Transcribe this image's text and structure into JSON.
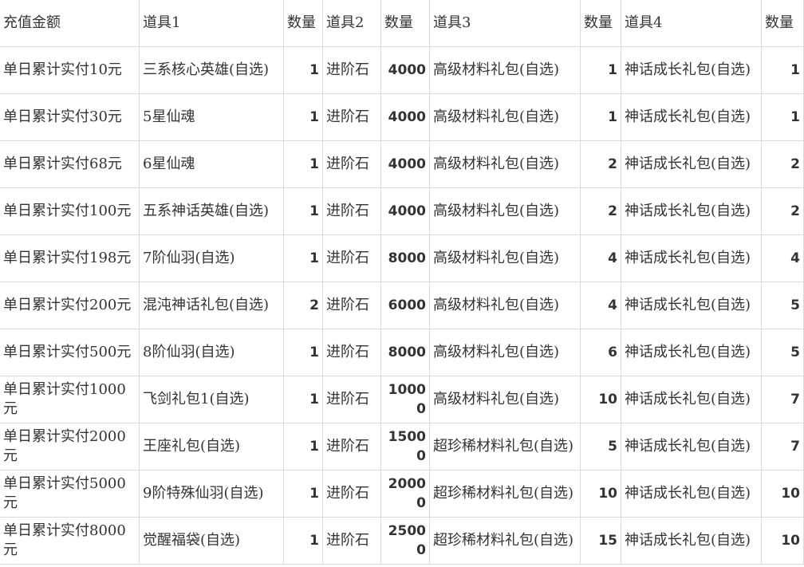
{
  "headers": [
    "充值金额",
    "道具1",
    "数量",
    "道具2",
    "数量",
    "道具3",
    "数量",
    "道具4",
    "数量"
  ],
  "rows": [
    [
      "单日累计实付10元",
      "三系核心英雄(自选)",
      "1",
      "进阶石",
      "4000",
      "高级材料礼包(自选)",
      "1",
      "神话成长礼包(自选)",
      "1"
    ],
    [
      "单日累计实付30元",
      "5星仙魂",
      "1",
      "进阶石",
      "4000",
      "高级材料礼包(自选)",
      "1",
      "神话成长礼包(自选)",
      "1"
    ],
    [
      "单日累计实付68元",
      "6星仙魂",
      "1",
      "进阶石",
      "4000",
      "高级材料礼包(自选)",
      "2",
      "神话成长礼包(自选)",
      "2"
    ],
    [
      "单日累计实付100元",
      "五系神话英雄(自选)",
      "1",
      "进阶石",
      "4000",
      "高级材料礼包(自选)",
      "2",
      "神话成长礼包(自选)",
      "2"
    ],
    [
      "单日累计实付198元",
      "7阶仙羽(自选)",
      "1",
      "进阶石",
      "8000",
      "高级材料礼包(自选)",
      "4",
      "神话成长礼包(自选)",
      "4"
    ],
    [
      "单日累计实付200元",
      "混沌神话礼包(自选)",
      "2",
      "进阶石",
      "6000",
      "高级材料礼包(自选)",
      "4",
      "神话成长礼包(自选)",
      "5"
    ],
    [
      "单日累计实付500元",
      "8阶仙羽(自选)",
      "1",
      "进阶石",
      "8000",
      "高级材料礼包(自选)",
      "6",
      "神话成长礼包(自选)",
      "5"
    ],
    [
      "单日累计实付1000元",
      "飞剑礼包1(自选)",
      "1",
      "进阶石",
      "10000",
      "高级材料礼包(自选)",
      "10",
      "神话成长礼包(自选)",
      "7"
    ],
    [
      "单日累计实付2000元",
      "王座礼包(自选)",
      "1",
      "进阶石",
      "15000",
      "超珍稀材料礼包(自选)",
      "5",
      "神话成长礼包(自选)",
      "7"
    ],
    [
      "单日累计实付5000元",
      "9阶特殊仙羽(自选)",
      "1",
      "进阶石",
      "20000",
      "超珍稀材料礼包(自选)",
      "10",
      "神话成长礼包(自选)",
      "10"
    ],
    [
      "单日累计实付8000元",
      "觉醒福袋(自选)",
      "1",
      "进阶石",
      "25000",
      "超珍稀材料礼包(自选)",
      "15",
      "神话成长礼包(自选)",
      "10"
    ]
  ]
}
